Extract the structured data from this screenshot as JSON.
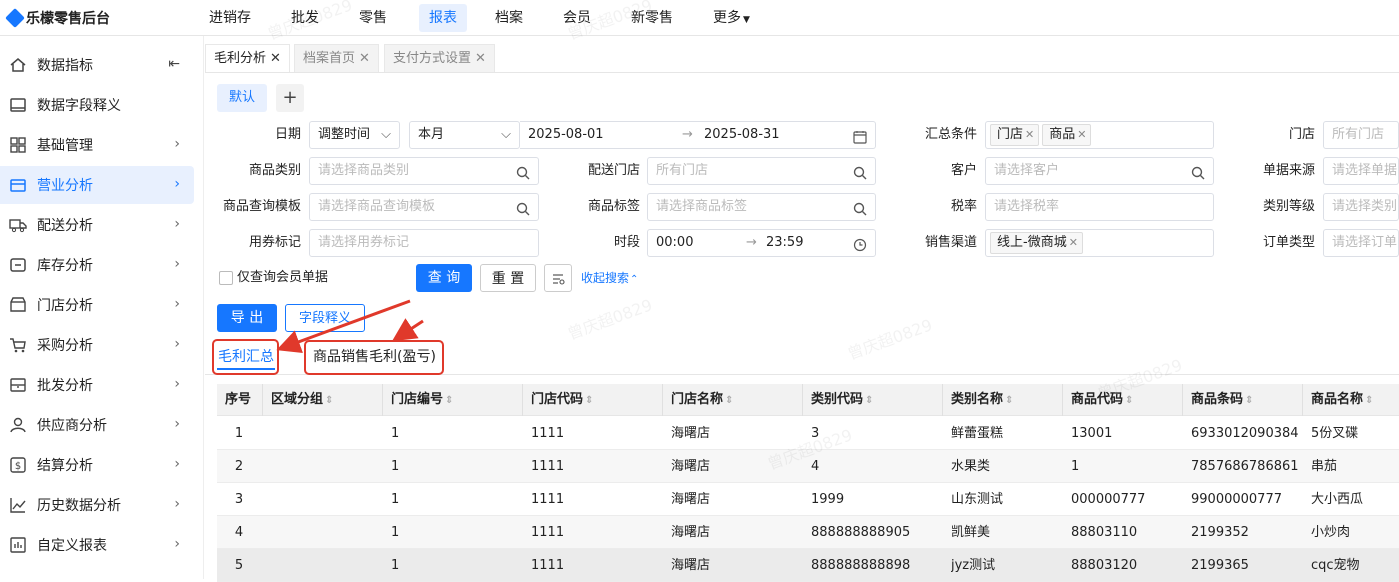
{
  "app": {
    "title": "乐檬零售后台"
  },
  "topnav": [
    "进销存",
    "批发",
    "零售",
    "报表",
    "档案",
    "会员",
    "新零售",
    "更多"
  ],
  "sidebar": {
    "items": [
      {
        "label": "数据指标",
        "icon": "chart-icon"
      },
      {
        "label": "数据字段释义",
        "icon": "book-icon"
      },
      {
        "label": "基础管理",
        "icon": "grid-icon"
      },
      {
        "label": "营业分析",
        "icon": "store-icon"
      },
      {
        "label": "配送分析",
        "icon": "truck-icon"
      },
      {
        "label": "库存分析",
        "icon": "inventory-icon"
      },
      {
        "label": "门店分析",
        "icon": "shop-icon"
      },
      {
        "label": "采购分析",
        "icon": "cart-icon"
      },
      {
        "label": "批发分析",
        "icon": "wholesale-icon"
      },
      {
        "label": "供应商分析",
        "icon": "user-icon"
      },
      {
        "label": "结算分析",
        "icon": "money-icon"
      },
      {
        "label": "历史数据分析",
        "icon": "trend-icon"
      },
      {
        "label": "自定义报表",
        "icon": "report-icon"
      }
    ]
  },
  "pagetabs": [
    {
      "label": "毛利分析"
    },
    {
      "label": "档案首页"
    },
    {
      "label": "支付方式设置"
    }
  ],
  "presets": {
    "default": "默认",
    "add": "+"
  },
  "filters": {
    "date_label": "日期",
    "date_type": "调整时间",
    "date_range": "本月",
    "date_start": "2025-08-01",
    "date_arrow": "→",
    "date_end": "2025-08-31",
    "summary_label": "汇总条件",
    "summary_tags": [
      "门店",
      "商品"
    ],
    "store_label": "门店",
    "store_ph": "所有门店",
    "category_label": "商品类别",
    "category_ph": "请选择商品类别",
    "delivery_store_label": "配送门店",
    "delivery_store_ph": "所有门店",
    "customer_label": "客户",
    "customer_ph": "请选择客户",
    "source_label": "单据来源",
    "source_ph": "请选择单据",
    "template_label": "商品查询模板",
    "template_ph": "请选择商品查询模板",
    "goods_tag_label": "商品标签",
    "goods_tag_ph": "请选择商品标签",
    "tax_label": "税率",
    "tax_ph": "请选择税率",
    "cat_level_label": "类别等级",
    "cat_level_ph": "请选择类别",
    "coupon_label": "用券标记",
    "coupon_ph": "请选择用券标记",
    "time_label": "时段",
    "time_start": "00:00",
    "time_arrow": "→",
    "time_end": "23:59",
    "channel_label": "销售渠道",
    "channel_tags": [
      "线上-微商城"
    ],
    "order_type_label": "订单类型",
    "order_type_ph": "请选择订单",
    "member_only": "仅查询会员单据",
    "query": "查 询",
    "reset": "重 置",
    "collapse": "收起搜索"
  },
  "actions": {
    "export": "导 出",
    "field_desc": "字段释义"
  },
  "result_tabs": [
    "毛利汇总",
    "商品销售毛利(盈亏)"
  ],
  "table": {
    "headers": [
      "序号",
      "区域分组",
      "门店编号",
      "门店代码",
      "门店名称",
      "类别代码",
      "类别名称",
      "商品代码",
      "商品条码",
      "商品名称"
    ],
    "rows": [
      [
        "1",
        "",
        "1",
        "1111",
        "海曙店",
        "3",
        "鲜蕾蛋糕",
        "13001",
        "6933012090384",
        "5份叉碟"
      ],
      [
        "2",
        "",
        "1",
        "1111",
        "海曙店",
        "4",
        "水果类",
        "1",
        "7857686786861",
        "串茄"
      ],
      [
        "3",
        "",
        "1",
        "1111",
        "海曙店",
        "1999",
        "山东测试",
        "000000777",
        "99000000777",
        "大小西瓜"
      ],
      [
        "4",
        "",
        "1",
        "1111",
        "海曙店",
        "888888888905",
        "凯鲜美",
        "88803110",
        "2199352",
        "小炒肉"
      ],
      [
        "5",
        "",
        "1",
        "1111",
        "海曙店",
        "888888888898",
        "jyz测试",
        "88803120",
        "2199365",
        "cqc宠物"
      ]
    ]
  },
  "watermark": "曾庆超0829",
  "colors": {
    "accent": "#1677ff",
    "annotation": "#e0392b"
  }
}
